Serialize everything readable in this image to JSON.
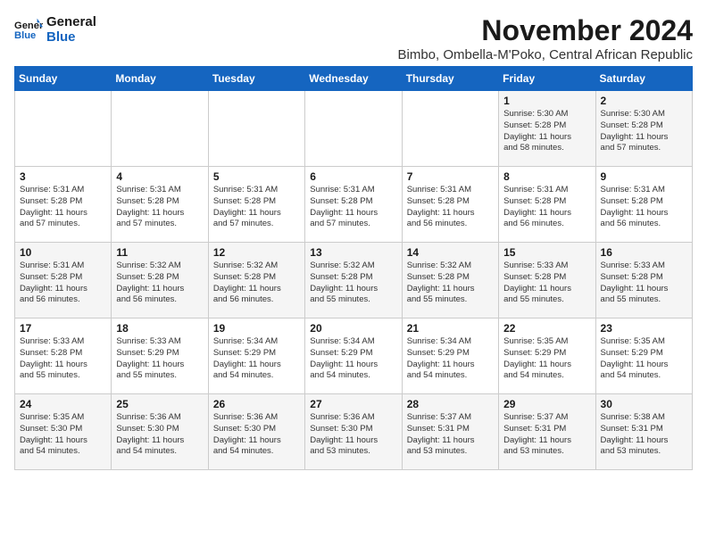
{
  "logo": {
    "line1": "General",
    "line2": "Blue"
  },
  "calendar": {
    "title": "November 2024",
    "subtitle": "Bimbo, Ombella-M'Poko, Central African Republic"
  },
  "headers": [
    "Sunday",
    "Monday",
    "Tuesday",
    "Wednesday",
    "Thursday",
    "Friday",
    "Saturday"
  ],
  "weeks": [
    [
      {
        "day": "",
        "info": ""
      },
      {
        "day": "",
        "info": ""
      },
      {
        "day": "",
        "info": ""
      },
      {
        "day": "",
        "info": ""
      },
      {
        "day": "",
        "info": ""
      },
      {
        "day": "1",
        "info": "Sunrise: 5:30 AM\nSunset: 5:28 PM\nDaylight: 11 hours\nand 58 minutes."
      },
      {
        "day": "2",
        "info": "Sunrise: 5:30 AM\nSunset: 5:28 PM\nDaylight: 11 hours\nand 57 minutes."
      }
    ],
    [
      {
        "day": "3",
        "info": "Sunrise: 5:31 AM\nSunset: 5:28 PM\nDaylight: 11 hours\nand 57 minutes."
      },
      {
        "day": "4",
        "info": "Sunrise: 5:31 AM\nSunset: 5:28 PM\nDaylight: 11 hours\nand 57 minutes."
      },
      {
        "day": "5",
        "info": "Sunrise: 5:31 AM\nSunset: 5:28 PM\nDaylight: 11 hours\nand 57 minutes."
      },
      {
        "day": "6",
        "info": "Sunrise: 5:31 AM\nSunset: 5:28 PM\nDaylight: 11 hours\nand 57 minutes."
      },
      {
        "day": "7",
        "info": "Sunrise: 5:31 AM\nSunset: 5:28 PM\nDaylight: 11 hours\nand 56 minutes."
      },
      {
        "day": "8",
        "info": "Sunrise: 5:31 AM\nSunset: 5:28 PM\nDaylight: 11 hours\nand 56 minutes."
      },
      {
        "day": "9",
        "info": "Sunrise: 5:31 AM\nSunset: 5:28 PM\nDaylight: 11 hours\nand 56 minutes."
      }
    ],
    [
      {
        "day": "10",
        "info": "Sunrise: 5:31 AM\nSunset: 5:28 PM\nDaylight: 11 hours\nand 56 minutes."
      },
      {
        "day": "11",
        "info": "Sunrise: 5:32 AM\nSunset: 5:28 PM\nDaylight: 11 hours\nand 56 minutes."
      },
      {
        "day": "12",
        "info": "Sunrise: 5:32 AM\nSunset: 5:28 PM\nDaylight: 11 hours\nand 56 minutes."
      },
      {
        "day": "13",
        "info": "Sunrise: 5:32 AM\nSunset: 5:28 PM\nDaylight: 11 hours\nand 55 minutes."
      },
      {
        "day": "14",
        "info": "Sunrise: 5:32 AM\nSunset: 5:28 PM\nDaylight: 11 hours\nand 55 minutes."
      },
      {
        "day": "15",
        "info": "Sunrise: 5:33 AM\nSunset: 5:28 PM\nDaylight: 11 hours\nand 55 minutes."
      },
      {
        "day": "16",
        "info": "Sunrise: 5:33 AM\nSunset: 5:28 PM\nDaylight: 11 hours\nand 55 minutes."
      }
    ],
    [
      {
        "day": "17",
        "info": "Sunrise: 5:33 AM\nSunset: 5:28 PM\nDaylight: 11 hours\nand 55 minutes."
      },
      {
        "day": "18",
        "info": "Sunrise: 5:33 AM\nSunset: 5:29 PM\nDaylight: 11 hours\nand 55 minutes."
      },
      {
        "day": "19",
        "info": "Sunrise: 5:34 AM\nSunset: 5:29 PM\nDaylight: 11 hours\nand 54 minutes."
      },
      {
        "day": "20",
        "info": "Sunrise: 5:34 AM\nSunset: 5:29 PM\nDaylight: 11 hours\nand 54 minutes."
      },
      {
        "day": "21",
        "info": "Sunrise: 5:34 AM\nSunset: 5:29 PM\nDaylight: 11 hours\nand 54 minutes."
      },
      {
        "day": "22",
        "info": "Sunrise: 5:35 AM\nSunset: 5:29 PM\nDaylight: 11 hours\nand 54 minutes."
      },
      {
        "day": "23",
        "info": "Sunrise: 5:35 AM\nSunset: 5:29 PM\nDaylight: 11 hours\nand 54 minutes."
      }
    ],
    [
      {
        "day": "24",
        "info": "Sunrise: 5:35 AM\nSunset: 5:30 PM\nDaylight: 11 hours\nand 54 minutes."
      },
      {
        "day": "25",
        "info": "Sunrise: 5:36 AM\nSunset: 5:30 PM\nDaylight: 11 hours\nand 54 minutes."
      },
      {
        "day": "26",
        "info": "Sunrise: 5:36 AM\nSunset: 5:30 PM\nDaylight: 11 hours\nand 54 minutes."
      },
      {
        "day": "27",
        "info": "Sunrise: 5:36 AM\nSunset: 5:30 PM\nDaylight: 11 hours\nand 53 minutes."
      },
      {
        "day": "28",
        "info": "Sunrise: 5:37 AM\nSunset: 5:31 PM\nDaylight: 11 hours\nand 53 minutes."
      },
      {
        "day": "29",
        "info": "Sunrise: 5:37 AM\nSunset: 5:31 PM\nDaylight: 11 hours\nand 53 minutes."
      },
      {
        "day": "30",
        "info": "Sunrise: 5:38 AM\nSunset: 5:31 PM\nDaylight: 11 hours\nand 53 minutes."
      }
    ]
  ]
}
